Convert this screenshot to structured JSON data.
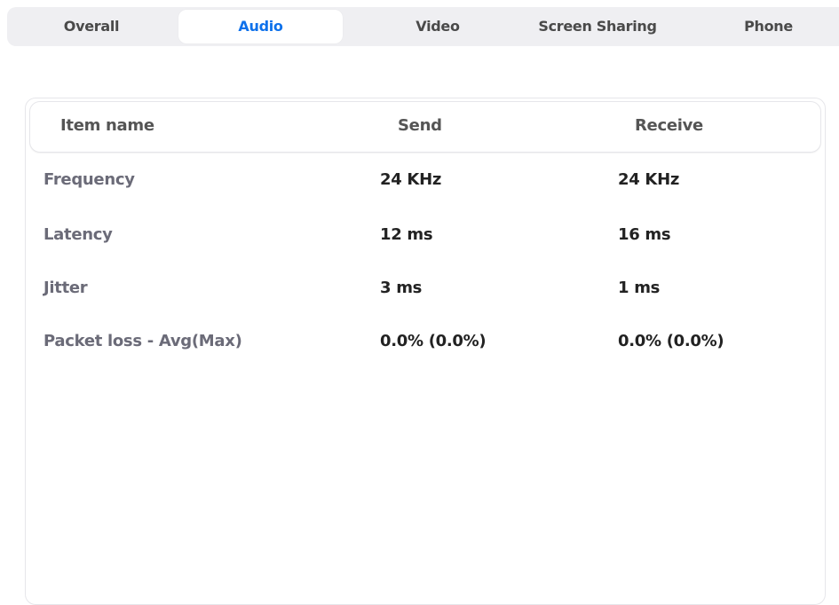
{
  "tabs": {
    "overall": "Overall",
    "audio": "Audio",
    "video": "Video",
    "screen_sharing": "Screen Sharing",
    "phone": "Phone",
    "active": "Audio",
    "active_color": "#0e71eb"
  },
  "table": {
    "headers": {
      "item_name": "Item name",
      "send": "Send",
      "receive": "Receive"
    },
    "rows": [
      {
        "item": "Frequency",
        "send": "24 KHz",
        "receive": "24 KHz"
      },
      {
        "item": "Latency",
        "send": "12 ms",
        "receive": "16 ms"
      },
      {
        "item": "Jitter",
        "send": "3 ms",
        "receive": "1 ms"
      },
      {
        "item": "Packet loss - Avg(Max)",
        "send": "0.0% (0.0%)",
        "receive": "0.0% (0.0%)"
      }
    ]
  }
}
